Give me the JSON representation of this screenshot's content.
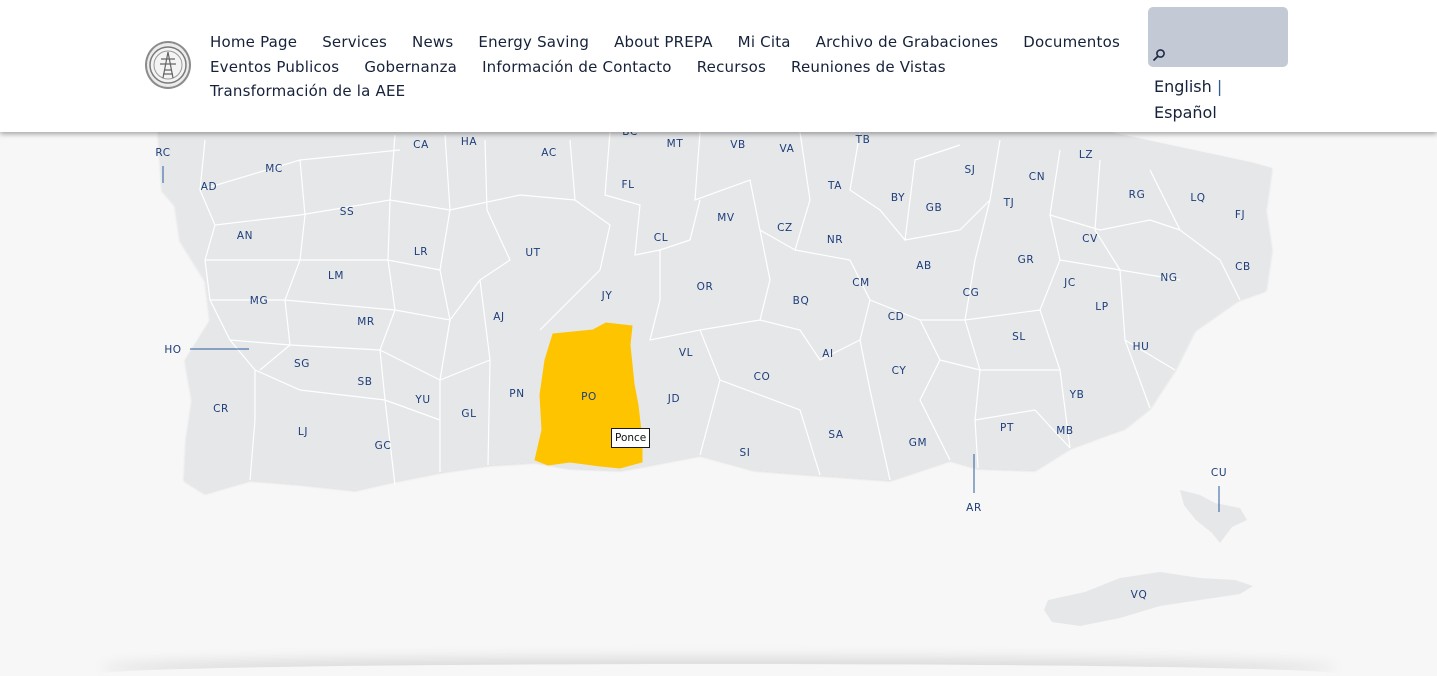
{
  "header": {
    "logo_icon": "power-tower-seal-icon",
    "nav": [
      "Home Page",
      "Services",
      "News",
      "Energy Saving",
      "About PREPA",
      "Mi Cita",
      "Archivo de Grabaciones",
      "Documentos",
      "Eventos Publicos",
      "Gobernanza",
      "Información de Contacto",
      "Recursos",
      "Reuniones de Vistas",
      "Transformación de la AEE"
    ],
    "search": {
      "placeholder": "",
      "icon": "search-icon"
    },
    "languages": {
      "english": "English",
      "separator": "|",
      "spanish": "Español"
    }
  },
  "map": {
    "highlight_color": "#ffc400",
    "land_color": "#e6e7e9",
    "border_color": "#ffffff",
    "label_color": "#1c3d7a",
    "tooltip": "Ponce",
    "labels": [
      "RC",
      "CA",
      "HA",
      "AC",
      "BC",
      "MT",
      "VB",
      "VA",
      "TB",
      "SJ",
      "LZ",
      "MC",
      "AD",
      "SS",
      "FL",
      "MV",
      "TA",
      "BY",
      "GB",
      "CN",
      "RG",
      "LQ",
      "FJ",
      "AN",
      "LR",
      "UT",
      "CL",
      "CZ",
      "NR",
      "TJ",
      "CV",
      "CB",
      "LM",
      "JY",
      "OR",
      "AB",
      "GR",
      "JC",
      "NG",
      "MG",
      "AJ",
      "BQ",
      "CM",
      "CG",
      "LP",
      "MR",
      "HO",
      "CD",
      "SL",
      "HU",
      "SG",
      "VL",
      "AI",
      "SB",
      "YU",
      "PN",
      "PO",
      "JD",
      "CO",
      "CY",
      "YB",
      "CR",
      "GL",
      "LJ",
      "GC",
      "SI",
      "SA",
      "GM",
      "PT",
      "MB",
      "CU",
      "AR",
      "VQ"
    ]
  }
}
